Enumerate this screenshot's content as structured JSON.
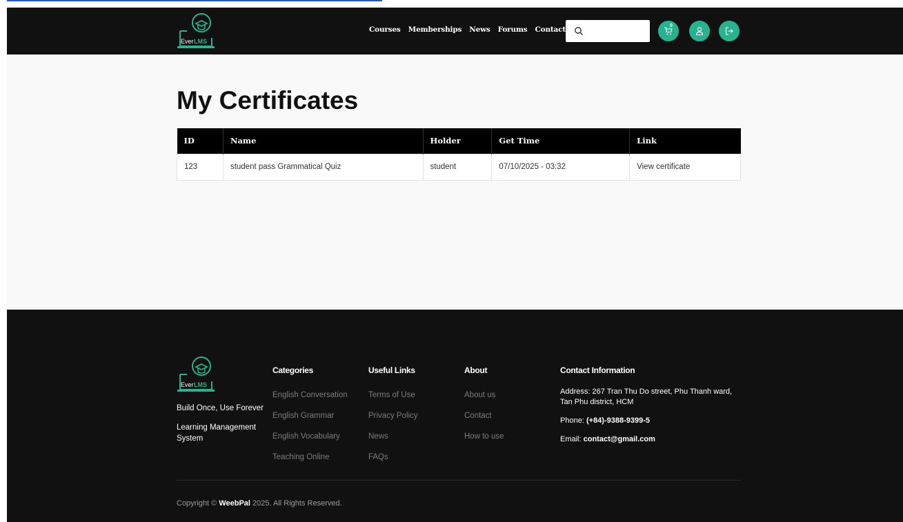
{
  "header": {
    "logo_text": "EverLMS",
    "nav": [
      "Courses",
      "Memberships",
      "News",
      "Forums",
      "Contact Us"
    ],
    "search": {
      "placeholder": "",
      "value": ""
    },
    "cart_count": "0"
  },
  "main": {
    "title": "My Certificates",
    "table": {
      "columns": [
        "ID",
        "Name",
        "Holder",
        "Get Time",
        "Link"
      ],
      "rows": [
        {
          "id": "123",
          "name": "student pass Grammatical Quiz",
          "holder": "student",
          "get_time": "07/10/2025 - 03:32",
          "link": "View certificate"
        }
      ]
    }
  },
  "footer": {
    "tagline": "Build Once, Use Forever",
    "subtitle": "Learning Management System",
    "categories": {
      "title": "Categories",
      "items": [
        "English Conversation",
        "English Grammar",
        "English Vocabulary",
        "Teaching Online"
      ]
    },
    "useful_links": {
      "title": "Useful Links",
      "items": [
        "Terms of Use",
        "Privacy Policy",
        "News",
        "FAQs"
      ]
    },
    "about": {
      "title": "About",
      "items": [
        "About us",
        "Contact",
        "How to use"
      ]
    },
    "contact": {
      "title": "Contact Information",
      "address_label": "Address:",
      "address": "267 Tran Thu Do street, Phu Thanh ward, Tan Phu district, HCM",
      "phone_label": "Phone:",
      "phone": "(+84)-9388-9399-5",
      "email_label": "Email:",
      "email": "contact@gmail.com"
    },
    "copyright_prefix": "Copyright ©",
    "copyright_brand": "WeebPal",
    "copyright_suffix": "2025. All Rights Reserved."
  },
  "colors": {
    "accent": "#25b48f",
    "header_bg": "#111111",
    "page_bg": "#f9f9f9"
  }
}
